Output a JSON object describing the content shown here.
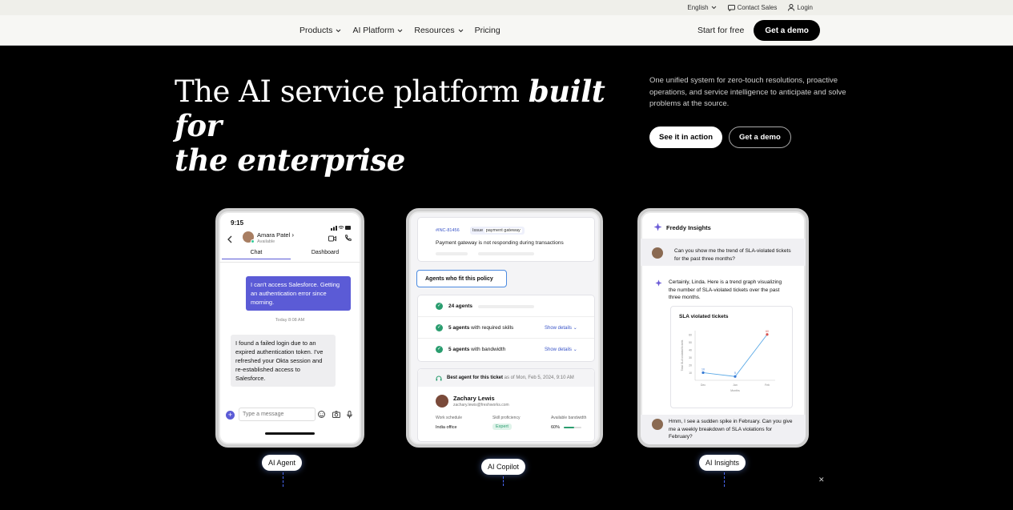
{
  "topbar": {
    "language": "English",
    "contact": "Contact Sales",
    "login": "Login"
  },
  "nav": {
    "items": [
      {
        "label": "Products",
        "has_menu": true
      },
      {
        "label": "AI Platform",
        "has_menu": true
      },
      {
        "label": "Resources",
        "has_menu": true
      },
      {
        "label": "Pricing",
        "has_menu": false
      }
    ],
    "start_free": "Start for free",
    "get_demo": "Get a demo"
  },
  "hero": {
    "title_plain": "The AI service platform ",
    "title_em1": "built for",
    "title_em2": "the enterprise",
    "description": "One unified system for zero-touch resolutions, proactive operations, and service intelligence to anticipate and solve problems at the source.",
    "btn_primary": "See it in action",
    "btn_secondary": "Get a demo"
  },
  "agent": {
    "time": "9:15",
    "contact_name": "Amara Patel",
    "contact_status": "Available",
    "tabs": [
      "Chat",
      "Dashboard"
    ],
    "msg_user": "I can't access Salesforce. Getting an authentication error since morning.",
    "timestamp": "Today 8:08 AM",
    "msg_bot": "I found a failed login due to an expired authentication token. I've refreshed your Okta session and re-established access to Salesforce.",
    "input_placeholder": "Type a message",
    "label": "AI Agent"
  },
  "copilot": {
    "ticket_id": "#INC-81456",
    "issue_tag": "Issue",
    "issue_value": "payment gateway",
    "ticket_title": "Payment gateway is not responding during transactions",
    "policy_label": "Agents who fit this policy",
    "rows": [
      {
        "bold": "24 agents",
        "rest": "",
        "link": ""
      },
      {
        "bold": "5 agents",
        "rest": " with required skills",
        "link": "Show details"
      },
      {
        "bold": "5 agents",
        "rest": " with bandwidth",
        "link": "Show details"
      }
    ],
    "best_agent_label": "Best agent for this ticket",
    "best_agent_time": " as of Mon, Feb 5, 2024, 9:10 AM",
    "agent_name": "Zachary Lewis",
    "agent_email": "zachary.lewis@freshworks.com",
    "col_headers": [
      "Work schedule",
      "Skill proficiency",
      "Available bandwidth"
    ],
    "col_values": [
      "India office",
      "Expert",
      "60%"
    ],
    "bandwidth": 0.6,
    "label": "AI Copilot"
  },
  "insights": {
    "header": "Freddy Insights",
    "q1": "Can you show me the trend of SLA-violated tickets for the past three months?",
    "a1": "Certainly, Linda. Here is a trend graph visualizing the number of SLA-violated tickets over the past three months.",
    "chart_title": "SLA violated tickets",
    "q2": "Hmm, I see a sudden spike in February. Can you give me a weekly breakdown of SLA violations for February?",
    "label": "AI Insights",
    "accent": "#5b5bd6"
  },
  "chart_data": {
    "type": "line",
    "title": "SLA violated tickets",
    "xlabel": "Months",
    "ylabel": "Total SLA violated tickets",
    "categories": [
      "Dec",
      "Jan",
      "Feb"
    ],
    "values": [
      10,
      5,
      60
    ],
    "yticks": [
      10,
      20,
      30,
      40,
      50,
      60
    ],
    "ylim": [
      0,
      65
    ]
  }
}
